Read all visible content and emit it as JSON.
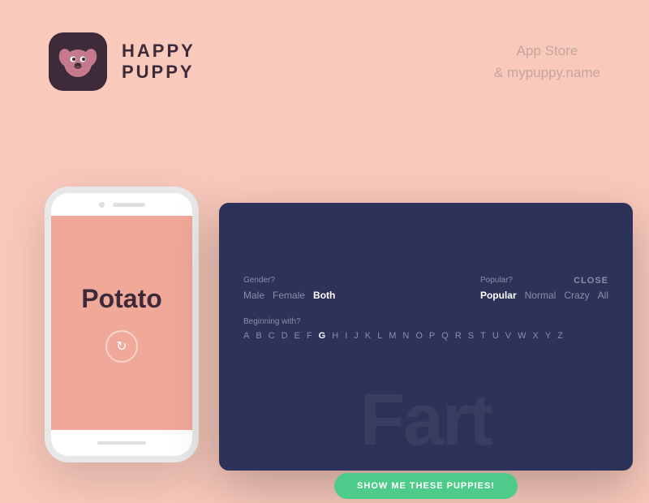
{
  "header": {
    "logo_line1": "HAPPY",
    "logo_line2": "PUPPY",
    "app_store_line1": "App Store",
    "app_store_line2": "& mypuppy.name"
  },
  "phone": {
    "dog_name": "Potato",
    "refresh_icon": "↻"
  },
  "laptop": {
    "close_label": "CLOSE",
    "gender_label": "Gender?",
    "gender_options": [
      {
        "label": "Male",
        "active": false
      },
      {
        "label": "Female",
        "active": false
      },
      {
        "label": "Both",
        "active": true
      }
    ],
    "popular_label": "Popular?",
    "popular_options": [
      {
        "label": "Popular",
        "active": true
      },
      {
        "label": "Normal",
        "active": false
      },
      {
        "label": "Crazy",
        "active": false
      },
      {
        "label": "All",
        "active": false
      }
    ],
    "beginning_label": "Beginning with?",
    "alphabet": [
      "A",
      "B",
      "C",
      "D",
      "E",
      "F",
      "G",
      "H",
      "I",
      "J",
      "K",
      "L",
      "M",
      "N",
      "O",
      "P",
      "Q",
      "R",
      "S",
      "T",
      "U",
      "V",
      "W",
      "X",
      "Y",
      "Z"
    ],
    "active_letter": "G",
    "bg_word": "Fart",
    "show_button": "SHOW ME THESE PUPPIES!"
  },
  "colors": {
    "bg": "#f9c9bc",
    "logo_bg": "#3d2b3a",
    "phone_screen": "#f0a898",
    "laptop_bg": "#2d3258",
    "accent_green": "#4ecb8a"
  }
}
